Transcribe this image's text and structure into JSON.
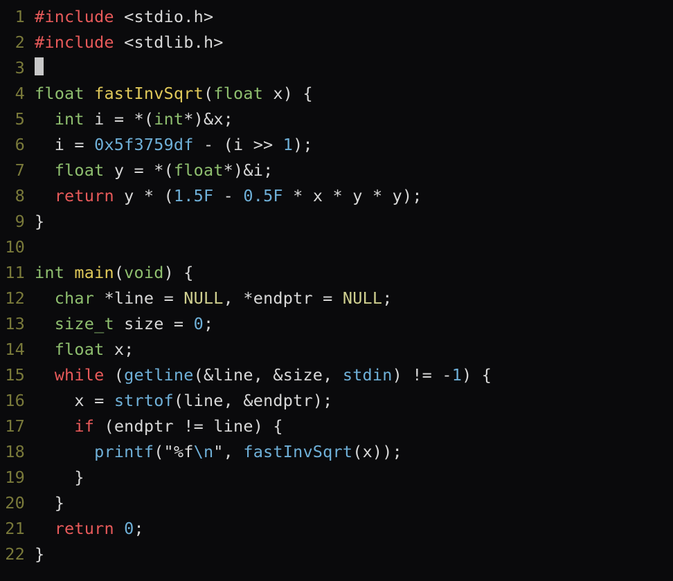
{
  "editor": {
    "language": "c",
    "cursor": {
      "line": 3,
      "col": 1
    },
    "lines": [
      {
        "n": 1,
        "tokens": [
          {
            "c": "pp",
            "t": "#include"
          },
          {
            "c": "op",
            "t": " "
          },
          {
            "c": "str",
            "t": "<stdio.h>"
          }
        ]
      },
      {
        "n": 2,
        "tokens": [
          {
            "c": "pp",
            "t": "#include"
          },
          {
            "c": "op",
            "t": " "
          },
          {
            "c": "str",
            "t": "<stdlib.h>"
          }
        ]
      },
      {
        "n": 3,
        "cursor": true,
        "tokens": []
      },
      {
        "n": 4,
        "tokens": [
          {
            "c": "kwT",
            "t": "float"
          },
          {
            "c": "op",
            "t": " "
          },
          {
            "c": "dfn",
            "t": "fastInvSqrt"
          },
          {
            "c": "op",
            "t": "("
          },
          {
            "c": "kwT",
            "t": "float"
          },
          {
            "c": "op",
            "t": " "
          },
          {
            "c": "ident",
            "t": "x"
          },
          {
            "c": "op",
            "t": ") {"
          }
        ]
      },
      {
        "n": 5,
        "tokens": [
          {
            "c": "op",
            "t": "  "
          },
          {
            "c": "kwT",
            "t": "int"
          },
          {
            "c": "op",
            "t": " "
          },
          {
            "c": "ident",
            "t": "i"
          },
          {
            "c": "op",
            "t": " = *("
          },
          {
            "c": "kwT",
            "t": "int"
          },
          {
            "c": "op",
            "t": "*)&"
          },
          {
            "c": "ident",
            "t": "x"
          },
          {
            "c": "op",
            "t": ";"
          }
        ]
      },
      {
        "n": 6,
        "tokens": [
          {
            "c": "op",
            "t": "  "
          },
          {
            "c": "ident",
            "t": "i"
          },
          {
            "c": "op",
            "t": " = "
          },
          {
            "c": "num",
            "t": "0x5f3759df"
          },
          {
            "c": "op",
            "t": " - ("
          },
          {
            "c": "ident",
            "t": "i"
          },
          {
            "c": "op",
            "t": " >> "
          },
          {
            "c": "num",
            "t": "1"
          },
          {
            "c": "op",
            "t": ");"
          }
        ]
      },
      {
        "n": 7,
        "tokens": [
          {
            "c": "op",
            "t": "  "
          },
          {
            "c": "kwT",
            "t": "float"
          },
          {
            "c": "op",
            "t": " "
          },
          {
            "c": "ident",
            "t": "y"
          },
          {
            "c": "op",
            "t": " = *("
          },
          {
            "c": "kwT",
            "t": "float"
          },
          {
            "c": "op",
            "t": "*)&"
          },
          {
            "c": "ident",
            "t": "i"
          },
          {
            "c": "op",
            "t": ";"
          }
        ]
      },
      {
        "n": 8,
        "tokens": [
          {
            "c": "op",
            "t": "  "
          },
          {
            "c": "kwC",
            "t": "return"
          },
          {
            "c": "op",
            "t": " "
          },
          {
            "c": "ident",
            "t": "y"
          },
          {
            "c": "op",
            "t": " * ("
          },
          {
            "c": "num",
            "t": "1.5F"
          },
          {
            "c": "op",
            "t": " - "
          },
          {
            "c": "num",
            "t": "0.5F"
          },
          {
            "c": "op",
            "t": " * "
          },
          {
            "c": "ident",
            "t": "x"
          },
          {
            "c": "op",
            "t": " * "
          },
          {
            "c": "ident",
            "t": "y"
          },
          {
            "c": "op",
            "t": " * "
          },
          {
            "c": "ident",
            "t": "y"
          },
          {
            "c": "op",
            "t": ");"
          }
        ]
      },
      {
        "n": 9,
        "tokens": [
          {
            "c": "op",
            "t": "}"
          }
        ]
      },
      {
        "n": 10,
        "tokens": []
      },
      {
        "n": 11,
        "tokens": [
          {
            "c": "kwT",
            "t": "int"
          },
          {
            "c": "op",
            "t": " "
          },
          {
            "c": "dfn",
            "t": "main"
          },
          {
            "c": "op",
            "t": "("
          },
          {
            "c": "kwT",
            "t": "void"
          },
          {
            "c": "op",
            "t": ") {"
          }
        ]
      },
      {
        "n": 12,
        "tokens": [
          {
            "c": "op",
            "t": "  "
          },
          {
            "c": "kwT",
            "t": "char"
          },
          {
            "c": "op",
            "t": " *"
          },
          {
            "c": "ident",
            "t": "line"
          },
          {
            "c": "op",
            "t": " = "
          },
          {
            "c": "cnst",
            "t": "NULL"
          },
          {
            "c": "op",
            "t": ", *"
          },
          {
            "c": "ident",
            "t": "endptr"
          },
          {
            "c": "op",
            "t": " = "
          },
          {
            "c": "cnst",
            "t": "NULL"
          },
          {
            "c": "op",
            "t": ";"
          }
        ]
      },
      {
        "n": 13,
        "tokens": [
          {
            "c": "op",
            "t": "  "
          },
          {
            "c": "kwT",
            "t": "size_t"
          },
          {
            "c": "op",
            "t": " "
          },
          {
            "c": "ident",
            "t": "size"
          },
          {
            "c": "op",
            "t": " = "
          },
          {
            "c": "num",
            "t": "0"
          },
          {
            "c": "op",
            "t": ";"
          }
        ]
      },
      {
        "n": 14,
        "tokens": [
          {
            "c": "op",
            "t": "  "
          },
          {
            "c": "kwT",
            "t": "float"
          },
          {
            "c": "op",
            "t": " "
          },
          {
            "c": "ident",
            "t": "x"
          },
          {
            "c": "op",
            "t": ";"
          }
        ]
      },
      {
        "n": 15,
        "tokens": [
          {
            "c": "op",
            "t": "  "
          },
          {
            "c": "kwC",
            "t": "while"
          },
          {
            "c": "op",
            "t": " ("
          },
          {
            "c": "fn",
            "t": "getline"
          },
          {
            "c": "op",
            "t": "(&"
          },
          {
            "c": "ident",
            "t": "line"
          },
          {
            "c": "op",
            "t": ", &"
          },
          {
            "c": "ident",
            "t": "size"
          },
          {
            "c": "op",
            "t": ", "
          },
          {
            "c": "fn",
            "t": "stdin"
          },
          {
            "c": "op",
            "t": ") != -"
          },
          {
            "c": "num",
            "t": "1"
          },
          {
            "c": "op",
            "t": ") {"
          }
        ]
      },
      {
        "n": 16,
        "tokens": [
          {
            "c": "op",
            "t": "    "
          },
          {
            "c": "ident",
            "t": "x"
          },
          {
            "c": "op",
            "t": " = "
          },
          {
            "c": "fn",
            "t": "strtof"
          },
          {
            "c": "op",
            "t": "("
          },
          {
            "c": "ident",
            "t": "line"
          },
          {
            "c": "op",
            "t": ", &"
          },
          {
            "c": "ident",
            "t": "endptr"
          },
          {
            "c": "op",
            "t": ");"
          }
        ]
      },
      {
        "n": 17,
        "tokens": [
          {
            "c": "op",
            "t": "    "
          },
          {
            "c": "kwC",
            "t": "if"
          },
          {
            "c": "op",
            "t": " ("
          },
          {
            "c": "ident",
            "t": "endptr"
          },
          {
            "c": "op",
            "t": " != "
          },
          {
            "c": "ident",
            "t": "line"
          },
          {
            "c": "op",
            "t": ") {"
          }
        ]
      },
      {
        "n": 18,
        "tokens": [
          {
            "c": "op",
            "t": "      "
          },
          {
            "c": "fn",
            "t": "printf"
          },
          {
            "c": "op",
            "t": "("
          },
          {
            "c": "qstr",
            "t": "\"%f"
          },
          {
            "c": "esc",
            "t": "\\n"
          },
          {
            "c": "qstr",
            "t": "\""
          },
          {
            "c": "op",
            "t": ", "
          },
          {
            "c": "fn",
            "t": "fastInvSqrt"
          },
          {
            "c": "op",
            "t": "("
          },
          {
            "c": "ident",
            "t": "x"
          },
          {
            "c": "op",
            "t": "));"
          }
        ]
      },
      {
        "n": 19,
        "tokens": [
          {
            "c": "op",
            "t": "    }"
          }
        ]
      },
      {
        "n": 20,
        "tokens": [
          {
            "c": "op",
            "t": "  }"
          }
        ]
      },
      {
        "n": 21,
        "tokens": [
          {
            "c": "op",
            "t": "  "
          },
          {
            "c": "kwC",
            "t": "return"
          },
          {
            "c": "op",
            "t": " "
          },
          {
            "c": "num",
            "t": "0"
          },
          {
            "c": "op",
            "t": ";"
          }
        ]
      },
      {
        "n": 22,
        "tokens": [
          {
            "c": "op",
            "t": "}"
          }
        ]
      }
    ]
  }
}
